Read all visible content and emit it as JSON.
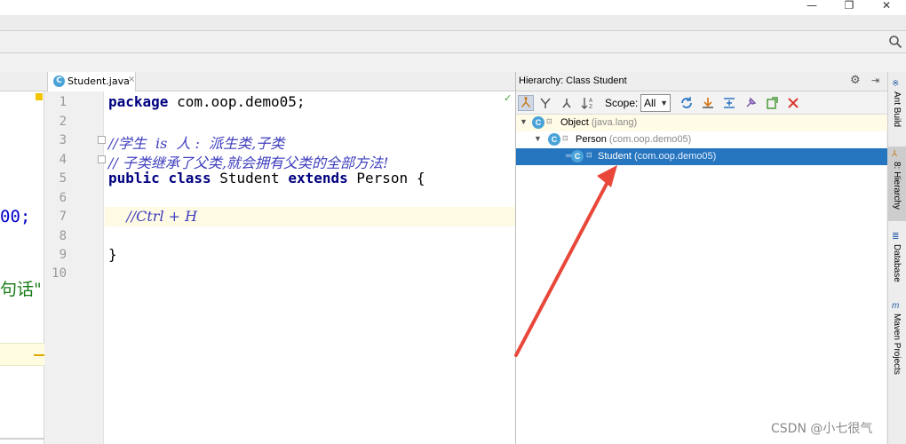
{
  "window": {
    "min_glyph": "—",
    "max_glyph": "❐",
    "close_glyph": "✕"
  },
  "left_fragment": {
    "line_a": "00;",
    "line_b": "句话\""
  },
  "editor": {
    "tab": {
      "icon_letter": "C",
      "label": "Student.java",
      "close_glyph": "×"
    },
    "line_numbers": [
      "1",
      "2",
      "3",
      "4",
      "5",
      "6",
      "7",
      "8",
      "9",
      "10"
    ],
    "lines": {
      "l1_kw": "package",
      "l1_rest": " com.oop.demo05;",
      "l3": "//学生  is  人 :  派生类,子类",
      "l4": "// 子类继承了父类,就会拥有父类的全部方法!",
      "l5_kw1": "public",
      "l5_kw2": "class",
      "l5_name": " Student ",
      "l5_kw3": "extends",
      "l5_rest": " Person {",
      "l7": "    //Ctrl + H",
      "l9": "}"
    },
    "check_glyph": "✓"
  },
  "hierarchy": {
    "title": "Hierarchy: Class Student",
    "gear_glyph": "⚙",
    "pin_glyph": "⇥",
    "scope_label": "Scope:",
    "scope_value": "All",
    "toolbar_icons": [
      "subtypes-icon",
      "supertypes-icon",
      "class-hierarchy-icon",
      "sort-icon",
      "refresh-icon",
      "export-icon",
      "expand-all-icon",
      "pin-icon",
      "open-icon",
      "close-icon"
    ],
    "tree": [
      {
        "name": "Object",
        "pkg": "(java.lang)"
      },
      {
        "name": "Person",
        "pkg": "(com.oop.demo05)"
      },
      {
        "name": "Student",
        "pkg": "(com.oop.demo05)"
      }
    ]
  },
  "side_tabs": [
    "Ant Build",
    "8: Hierarchy",
    "Database",
    "Maven Projects"
  ],
  "colors": {
    "selection": "#2675bf",
    "annotation_arrow": "#e8473a",
    "keyword": "#000080",
    "comment": "#3d3dbe"
  },
  "watermark": "CSDN @小七很气"
}
